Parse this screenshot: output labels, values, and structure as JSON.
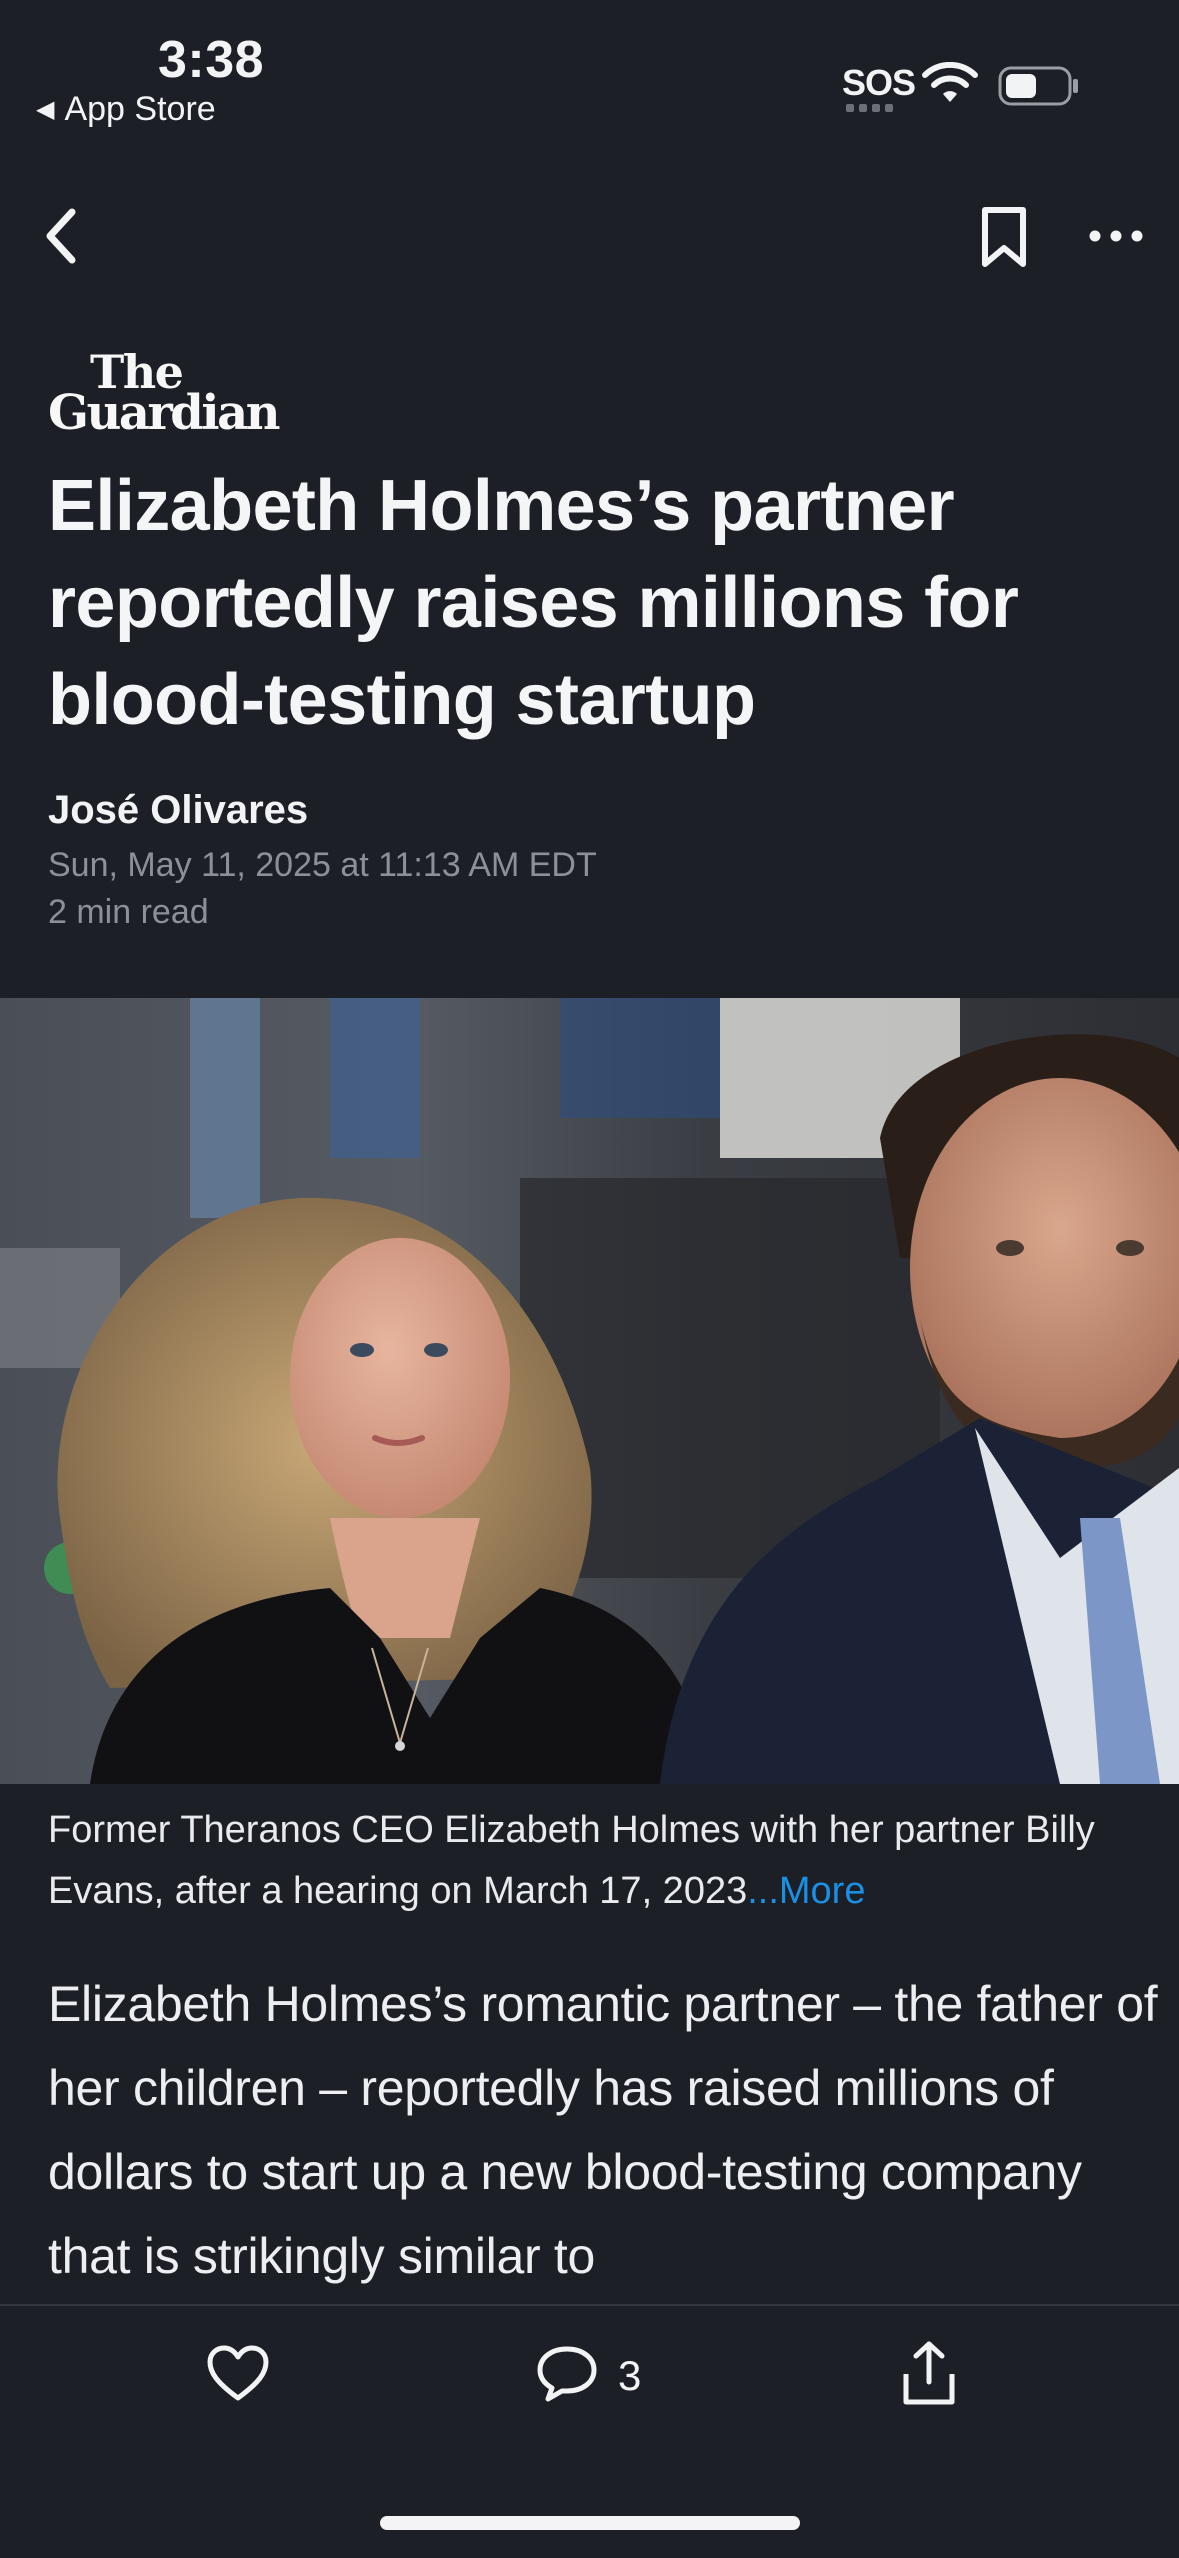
{
  "status_bar": {
    "time": "3:38",
    "back_app_label": "App Store",
    "sos": "SOS"
  },
  "nav": {
    "icons": [
      "back-icon",
      "bookmark-icon",
      "more-icon"
    ]
  },
  "article": {
    "publisher": {
      "line1": "The",
      "line2": "Guardian"
    },
    "headline": "Elizabeth Holmes’s partner reportedly raises millions for blood-testing startup",
    "author": "José Olivares",
    "date": "Sun, May 11, 2025 at 11:13 AM EDT",
    "read_time": "2 min read",
    "caption": "Former Theranos CEO Elizabeth Holmes with her partner Billy Evans, after a hearing on March 17, 2023",
    "caption_more": "...More",
    "body": "Elizabeth Holmes’s romantic partner – the father of her children – reportedly has raised millions of dollars to start up a new blood-testing company that is strikingly similar to"
  },
  "bottom_bar": {
    "comment_count": "3",
    "icons": [
      "heart-icon",
      "comment-icon",
      "share-icon"
    ]
  },
  "colors": {
    "background": "#1c1f26",
    "accent_link": "#1a8fe3",
    "muted_text": "#8d9099"
  }
}
